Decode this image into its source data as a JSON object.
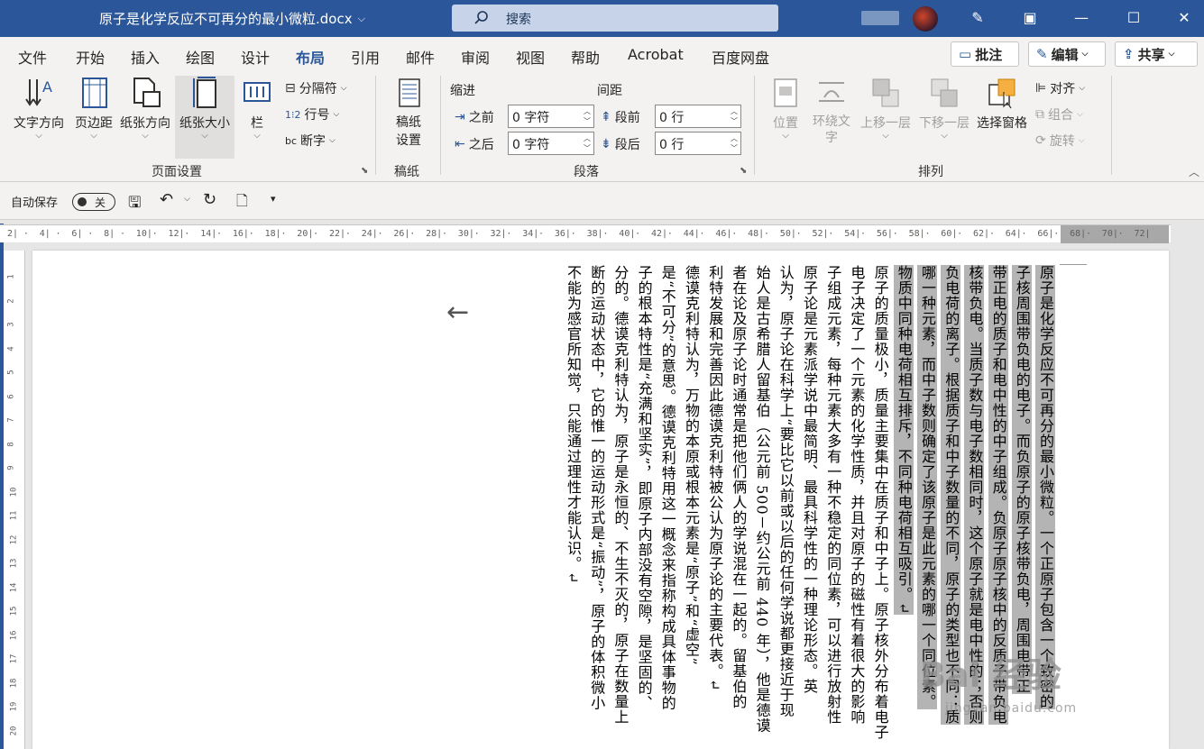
{
  "titlebar": {
    "doc_title": "原子是化学反应不可再分的最小微粒.docx",
    "search_label": "搜索"
  },
  "tabs": [
    "文件",
    "开始",
    "插入",
    "绘图",
    "设计",
    "布局",
    "引用",
    "邮件",
    "审阅",
    "视图",
    "帮助",
    "Acrobat",
    "百度网盘"
  ],
  "active_tab": "布局",
  "right_buttons": {
    "comment": "批注",
    "edit": "编辑",
    "share": "共享"
  },
  "ribbon": {
    "page_setup": {
      "text_direction": "文字方向",
      "margins": "页边距",
      "orientation": "纸张方向",
      "size": "纸张大小",
      "columns": "栏",
      "breaks": "分隔符",
      "line_numbers": "行号",
      "hyphenation": "断字",
      "group_label": "页面设置"
    },
    "manuscript": {
      "button": "稿纸\n设置",
      "group_label": "稿纸"
    },
    "paragraph": {
      "indent_title": "缩进",
      "spacing_title": "间距",
      "indent_before_label": "之前",
      "indent_before_value": "0 字符",
      "indent_after_label": "之后",
      "indent_after_value": "0 字符",
      "space_before_label": "段前",
      "space_before_value": "0 行",
      "space_after_label": "段后",
      "space_after_value": "0 行",
      "group_label": "段落"
    },
    "arrange": {
      "position": "位置",
      "wrap_text": "环绕文\n字",
      "bring_forward": "上移一层",
      "send_backward": "下移一层",
      "selection_pane": "选择窗格",
      "align": "对齐",
      "group": "组合",
      "rotate": "旋转",
      "group_label": "排列"
    }
  },
  "qat": {
    "autosave": "自动保存",
    "toggle": "关"
  },
  "ruler_ticks": [
    "2",
    "",
    "4",
    "",
    "6",
    "",
    "8",
    "",
    "10",
    "",
    "12",
    "",
    "14",
    "",
    "16",
    "",
    "18",
    "",
    "20",
    "",
    "22",
    "",
    "24",
    "",
    "26",
    "",
    "28",
    "",
    "30",
    "",
    "32",
    "",
    "34",
    "",
    "36",
    "",
    "38",
    "",
    "40",
    "",
    "42",
    "",
    "44",
    "",
    "46",
    "",
    "48",
    "",
    "50",
    "",
    "52",
    "",
    "54",
    "",
    "56",
    "",
    "58",
    "",
    "60",
    "",
    "62",
    "",
    "64",
    "",
    "66",
    "",
    "68",
    "",
    "70",
    "",
    "72"
  ],
  "vruler_ticks": [
    "1",
    "2",
    "3",
    "4",
    "5",
    "6",
    "7",
    "8",
    "9",
    "10",
    "11",
    "12",
    "13",
    "14",
    "15",
    "16",
    "17",
    "18",
    "19",
    "20"
  ],
  "document": {
    "columns": [
      {
        "text": "原子是化学反应不可再分的最小微粒。一个正原子包含一个致密的",
        "hl": true
      },
      {
        "text": "子核周围带负电的电子。而负原子的原子核带负电，周围电带正",
        "hl": true
      },
      {
        "text": "带正电的质子和电中性的中子组成。负原子原子核中的反质子带负电",
        "hl": true
      },
      {
        "text": "核带负电。当质子数与电子数相同时，这个原子就是电中性的；否则",
        "hl": true
      },
      {
        "text": "负电荷的离子。根据质子和中子数量的不同，原子的类型也不同：质",
        "hl": true
      },
      {
        "text": "哪一种元素，而中子数则确定了该原子是此元素的哪一个同位素。",
        "hl": true
      },
      {
        "text": "物质中同种电荷相互排斥，不同种电荷相互吸引。↵",
        "hl": true
      },
      {
        "text": "原子的质量极小，质量主要集中在质子和中子上。原子核外分布着电子",
        "hl": false
      },
      {
        "text": "电子决定了一个元素的化学性质，并且对原子的磁性有着很大的影响",
        "hl": false
      },
      {
        "text": "子组成元素，每种元素大多有一种不稳定的同位素，可以进行放射性",
        "hl": false
      },
      {
        "text": "原子论是元素派学说中最简明、最具科学性的一种理论形态。英",
        "hl": false
      },
      {
        "text": "认为，原子论在科学上“要比它以前或以后的任何学说都更接近于现",
        "hl": false
      },
      {
        "text": "始人是古希腊人留基伯（公元前 500－约公元前 440 年），他是德谟",
        "hl": false
      },
      {
        "text": "者在论及原子论时通常是把他们俩人的学说混在一起的。留基伯的",
        "hl": false
      },
      {
        "text": "利特发展和完善因此德谟克利特被公认为原子论的主要代表。↵",
        "hl": false
      },
      {
        "text": "德谟克利特认为，万物的本原或根本元素是“原子”和“虚空”",
        "hl": false
      },
      {
        "text": "是“不可分”的意思。德谟克利特用这一概念来指称构成具体事物的",
        "hl": false
      },
      {
        "text": "子的根本特性是“充满和坚实”，即原子内部没有空隙，是坚固的、",
        "hl": false
      },
      {
        "text": "分的。德谟克利特认为，原子是永恒的、不生不灭的，原子在数量上",
        "hl": false
      },
      {
        "text": "断的运动状态中，它的惟一的运动形式是“振动”，原子的体积微小",
        "hl": false
      },
      {
        "text": "不能为感官所知觉，只能通过理性才能认识。↵",
        "hl": false
      }
    ]
  },
  "watermark": {
    "text": "Bai 经验",
    "sub": "jingyan.baidu.com"
  },
  "colors": {
    "titlebar": "#2b579a",
    "accent": "#2b579a",
    "highlight": "#b4b4b4"
  }
}
